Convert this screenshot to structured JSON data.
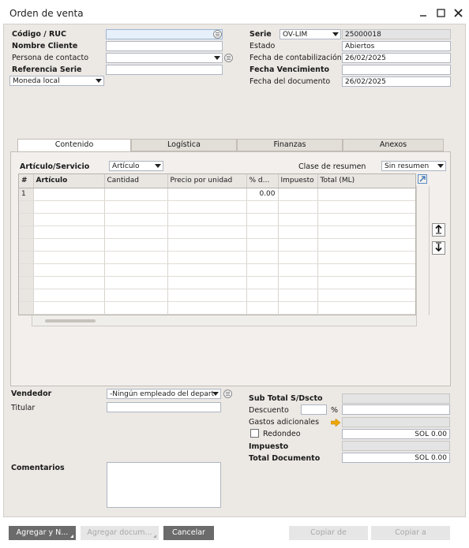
{
  "window": {
    "title": "Orden de venta"
  },
  "header_left": {
    "codigo_label": "Código / RUC",
    "nombre_label": "Nombre Cliente",
    "contacto_label": "Persona de contacto",
    "referencia_label": "Referencia Serie",
    "moneda_value": "Moneda local"
  },
  "header_right": {
    "serie_label": "Serie",
    "serie_value": "OV-LIM",
    "serie_number": "25000018",
    "estado_label": "Estado",
    "estado_value": "Abiertos",
    "fecha_contab_label": "Fecha de contabilización",
    "fecha_contab_value": "26/02/2025",
    "fecha_venc_label": "Fecha Vencimiento",
    "fecha_doc_label": "Fecha del documento",
    "fecha_doc_value": "26/02/2025"
  },
  "tabs": [
    "Contenido",
    "Logística",
    "Finanzas",
    "Anexos"
  ],
  "content": {
    "articulo_servicio_label": "Artículo/Servicio",
    "articulo_servicio_value": "Artículo",
    "clase_resumen_label": "Clase de resumen",
    "clase_resumen_value": "Sin resumen",
    "columns": [
      "#",
      "Artículo",
      "Cantidad",
      "Precio por unidad",
      "% d...",
      "Impuesto",
      "Total (ML)"
    ],
    "rows": [
      {
        "num": "1",
        "discount": "0.00"
      }
    ]
  },
  "footer_left": {
    "vendedor_label": "Vendedor",
    "vendedor_value": "-Ningún empleado del depart",
    "titular_label": "Titular",
    "comentarios_label": "Comentarios"
  },
  "totals": {
    "subtotal_label": "Sub Total S/Dscto",
    "descuento_label": "Descuento",
    "percent_sign": "%",
    "gastos_label": "Gastos adicionales",
    "redondeo_label": "Redondeo",
    "redondeo_value": "SOL 0.00",
    "impuesto_label": "Impuesto",
    "total_label": "Total Documento",
    "total_value": "SOL 0.00"
  },
  "buttons": {
    "agregar": "Agregar y N...",
    "agregar_doc": "Agregar docum...",
    "cancelar": "Cancelar",
    "copiar_de": "Copiar de",
    "copiar_a": "Copiar a"
  },
  "colors": {
    "accent_dark_button": "#6b6b6b",
    "form_background": "#ece8e4",
    "arrow_orange": "#f0a800"
  }
}
